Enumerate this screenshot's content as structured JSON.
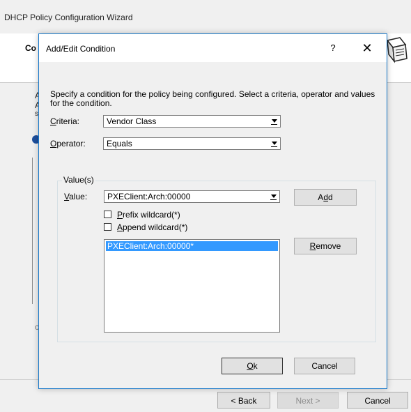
{
  "wizard": {
    "title": "DHCP Policy Configuration Wizard",
    "heading_fragment": "Co",
    "body_fragments": [
      "A",
      "A",
      "s",
      "c"
    ],
    "buttons": {
      "back": "< Back",
      "next": "Next >",
      "cancel": "Cancel"
    }
  },
  "dialog": {
    "title": "Add/Edit Condition",
    "help_glyph": "?",
    "close_glyph": "✕",
    "instructions": "Specify a condition for the policy being configured. Select a criteria, operator and values for the condition.",
    "criteria": {
      "label_mnemonic": "C",
      "label_rest": "riteria:",
      "value": "Vendor Class"
    },
    "operator": {
      "label_mnemonic": "O",
      "label_rest": "perator:",
      "value": "Equals"
    },
    "values_group": {
      "legend": "Value(s)",
      "value": {
        "label_mnemonic": "V",
        "label_rest": "alue:",
        "current": "PXEClient:Arch:00000"
      },
      "add_button": {
        "pre": "A",
        "mnemonic": "d",
        "post": "d"
      },
      "prefix_wildcard": {
        "mnemonic": "P",
        "rest": "refix wildcard(*)",
        "checked": false
      },
      "append_wildcard": {
        "mnemonic": "A",
        "rest": "ppend wildcard(*)",
        "checked": false
      },
      "list_items": [
        "PXEClient:Arch:00000*"
      ],
      "remove_button": {
        "mnemonic": "R",
        "rest": "emove"
      }
    },
    "ok_button": {
      "mnemonic": "O",
      "rest": "k"
    },
    "cancel_button": "Cancel"
  },
  "colors": {
    "dialog_border": "#1979ca",
    "selection": "#3399ff",
    "window_bg": "#f0f0f0"
  }
}
